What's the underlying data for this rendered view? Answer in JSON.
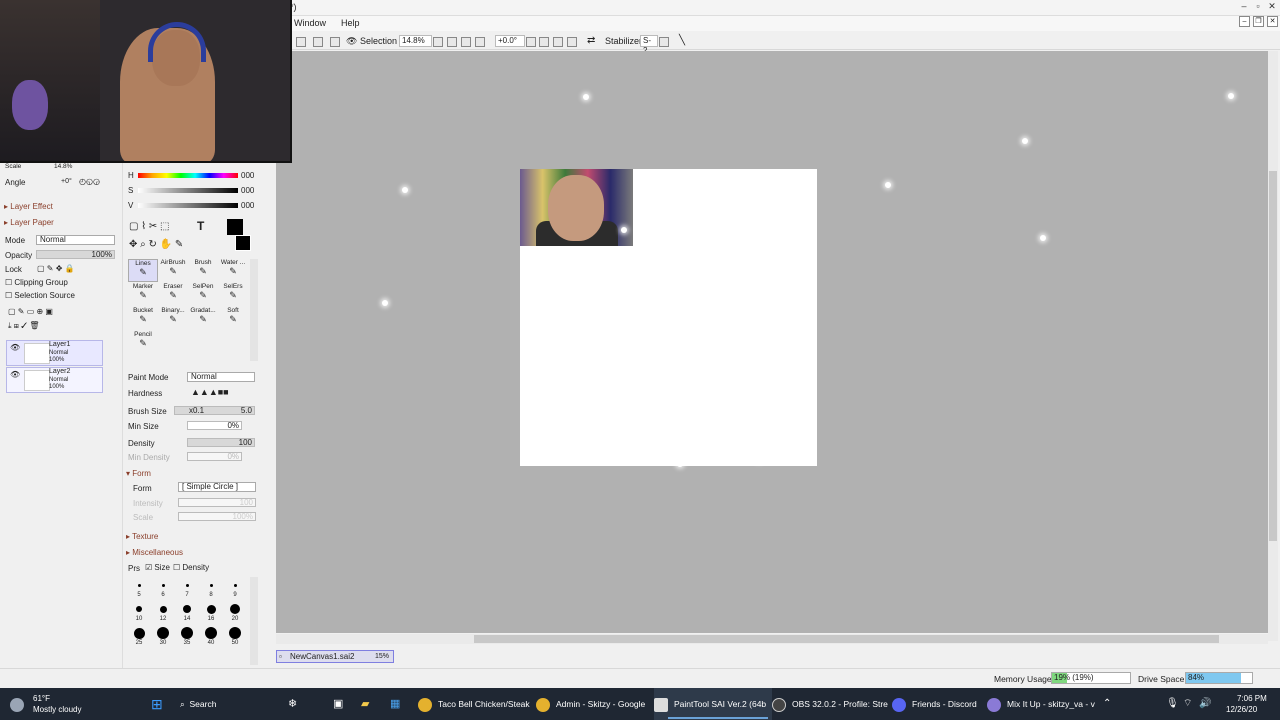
{
  "titlebar": {
    "title": "(*)"
  },
  "menu": {
    "window": "Window",
    "help": "Help"
  },
  "toolbar": {
    "selection": "Selection",
    "zoom": "14.8%",
    "rotation": "+0.0°",
    "stabilizer_label": "Stabilizer",
    "stabilizer_value": "S-2"
  },
  "navigator": {
    "scale_label": "Scale",
    "scale_value": "14.8%",
    "angle_label": "Angle",
    "angle_value": "+0°"
  },
  "layer_panel": {
    "layer_effect": "Layer Effect",
    "layer_paper": "Layer Paper",
    "mode_label": "Mode",
    "mode_value": "Normal",
    "opacity_label": "Opacity",
    "opacity_value": "100%",
    "lock_label": "Lock",
    "clipping_group": "Clipping Group",
    "selection_source": "Selection Source",
    "layers": [
      {
        "name": "Layer1",
        "mode": "Normal",
        "opacity": "100%"
      },
      {
        "name": "Layer2",
        "mode": "Normal",
        "opacity": "100%"
      }
    ]
  },
  "color": {
    "h_label": "H",
    "s_label": "S",
    "v_label": "V",
    "h": "000",
    "s": "000",
    "v": "000"
  },
  "tools": [
    {
      "label": "Lines"
    },
    {
      "label": "AirBrush"
    },
    {
      "label": "Brush"
    },
    {
      "label": "Water ..."
    },
    {
      "label": "Marker"
    },
    {
      "label": "Eraser"
    },
    {
      "label": "SelPen"
    },
    {
      "label": "SelErs"
    },
    {
      "label": "Bucket"
    },
    {
      "label": "Binary..."
    },
    {
      "label": "Gradat..."
    },
    {
      "label": "Soft"
    },
    {
      "label": "Pencil"
    }
  ],
  "brush": {
    "paint_mode_label": "Paint Mode",
    "paint_mode_value": "Normal",
    "hardness_label": "Hardness",
    "brush_size_label": "Brush Size",
    "brush_size_mult": "x0.1",
    "brush_size_value": "5.0",
    "min_size_label": "Min Size",
    "min_size_value": "0%",
    "density_label": "Density",
    "density_value": "100",
    "min_density_label": "Min Density",
    "min_density_value": "0%",
    "form_section": "Form",
    "form_label": "Form",
    "form_value": "[ Simple Circle ]",
    "intensity_label": "Intensity",
    "intensity_value": "100",
    "scale_label": "Scale",
    "scale_value": "100%",
    "texture": "Texture",
    "misc": "Miscellaneous",
    "prs": "Prs",
    "size": "Size",
    "density": "Density",
    "size_presets": [
      "5",
      "6",
      "7",
      "8",
      "9",
      "10",
      "12",
      "14",
      "16",
      "20",
      "25",
      "30",
      "35",
      "40",
      "50"
    ]
  },
  "document": {
    "tab_name": "NewCanvas1.sai2",
    "tab_zoom": "15%"
  },
  "status": {
    "memory_label": "Memory Usage",
    "memory_value": "19% (19%)",
    "memory_fraction": 0.19,
    "drive_label": "Drive Space",
    "drive_value": "84%",
    "drive_fraction": 0.84
  },
  "taskbar": {
    "weather_temp": "61°F",
    "weather_desc": "Mostly cloudy",
    "search": "Search",
    "apps": [
      "Taco Bell Chicken/Steak",
      "Admin - Skitzy - Google",
      "PaintTool SAI Ver.2 (64b",
      "OBS 32.0.2 - Profile: Stre",
      "Friends - Discord",
      "Mix It Up - skitzy_va - v"
    ],
    "time": "7:06 PM",
    "date": "12/26/20"
  },
  "colors": {
    "accent": "#6aa2d8",
    "canvas_bg": "#b1b1b1",
    "memory_fill": "#7fd87f",
    "drive_fill": "#7fc8f0"
  }
}
